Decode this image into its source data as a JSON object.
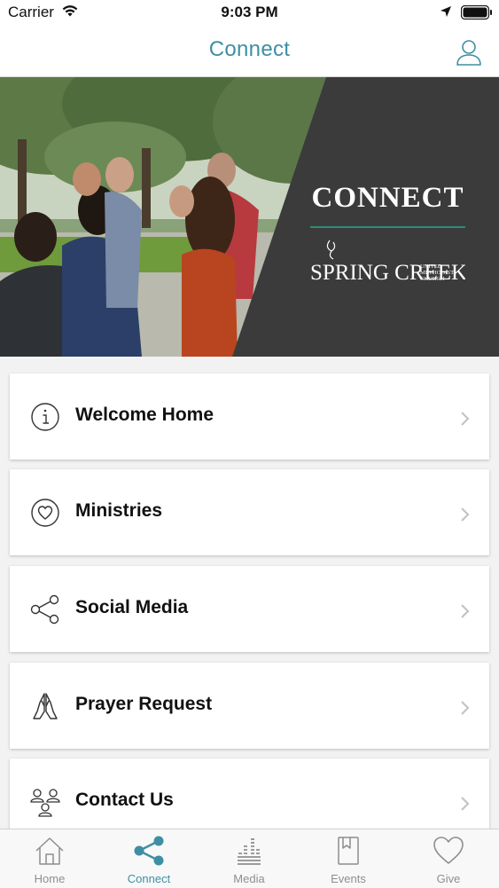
{
  "status_bar": {
    "carrier": "Carrier",
    "time": "9:03 PM"
  },
  "nav": {
    "title": "Connect"
  },
  "hero": {
    "title": "CONNECT",
    "logo_main": "SPRING CREEK",
    "logo_sub_1": "UNITED",
    "logo_sub_2": "METHODIST",
    "logo_sub_3": "CHURCH"
  },
  "menu": [
    {
      "label": "Welcome Home",
      "icon": "info-icon"
    },
    {
      "label": "Ministries",
      "icon": "heart-circle-icon"
    },
    {
      "label": "Social Media",
      "icon": "share-icon"
    },
    {
      "label": "Prayer Request",
      "icon": "praying-hands-icon"
    },
    {
      "label": "Contact Us",
      "icon": "people-icon"
    }
  ],
  "tabs": [
    {
      "label": "Home",
      "icon": "home-icon",
      "active": false
    },
    {
      "label": "Connect",
      "icon": "share-icon",
      "active": true
    },
    {
      "label": "Media",
      "icon": "equalizer-icon",
      "active": false
    },
    {
      "label": "Events",
      "icon": "bookmark-icon",
      "active": false
    },
    {
      "label": "Give",
      "icon": "heart-icon",
      "active": false
    }
  ],
  "colors": {
    "accent": "#3e8fa3",
    "hero_panel": "#3b3b3b",
    "rule_green": "#2f8a74",
    "tab_inactive": "#8e8e8e"
  }
}
